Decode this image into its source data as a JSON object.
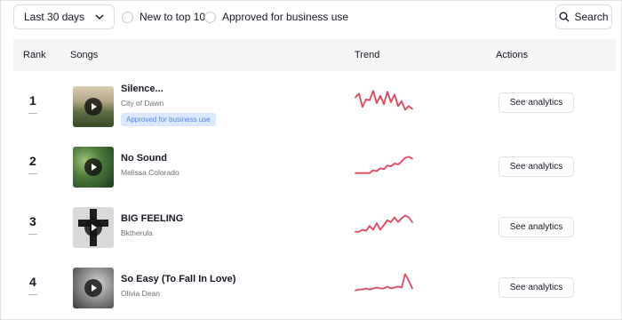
{
  "filters": {
    "period_label": "Last 30 days",
    "options": [
      {
        "label": "New to top 100",
        "checked": false
      },
      {
        "label": "Approved for business use",
        "checked": false
      }
    ],
    "search_label": "Search"
  },
  "table": {
    "headers": {
      "rank": "Rank",
      "songs": "Songs",
      "trend": "Trend",
      "actions": "Actions"
    },
    "rows": [
      {
        "rank": "1",
        "title": "Silence...",
        "artist": "City of Dawn",
        "badge": "Approved for business use",
        "action": "See analytics",
        "trend": [
          18,
          22,
          8,
          16,
          15,
          25,
          12,
          20,
          11,
          24,
          13,
          21,
          9,
          14,
          5,
          9,
          6
        ]
      },
      {
        "rank": "2",
        "title": "No Sound",
        "artist": "Melissa Colorado",
        "badge": "",
        "action": "See analytics",
        "trend": [
          4,
          4,
          4,
          4,
          4,
          7,
          6,
          9,
          8,
          12,
          11,
          14,
          13,
          16,
          20,
          21,
          19
        ]
      },
      {
        "rank": "3",
        "title": "BIG FEELING",
        "artist": "Bktherula",
        "badge": "",
        "action": "See analytics",
        "trend": [
          4,
          4,
          6,
          5,
          10,
          6,
          13,
          6,
          11,
          16,
          14,
          19,
          14,
          18,
          21,
          19,
          14
        ]
      },
      {
        "rank": "4",
        "title": "So Easy (To Fall In Love)",
        "artist": "Olivia Dean",
        "badge": "",
        "action": "See analytics",
        "trend": [
          4,
          5,
          5,
          6,
          5,
          6,
          7,
          6,
          6,
          8,
          6,
          7,
          8,
          7,
          21,
          14,
          6
        ]
      }
    ]
  },
  "colors": {
    "trend_line": "#e2455c",
    "badge_bg": "#dbe8fd",
    "badge_text": "#4f86e9"
  },
  "icons": {
    "dropdown": "chevron-down-icon",
    "search": "search-icon",
    "play": "play-icon"
  }
}
